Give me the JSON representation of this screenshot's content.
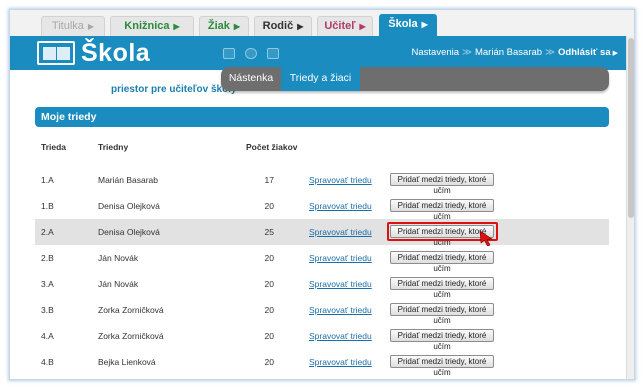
{
  "tabs": [
    {
      "label": "Titulka"
    },
    {
      "label": "Knižnica"
    },
    {
      "label": "Žiak"
    },
    {
      "label": "Rodič"
    },
    {
      "label": "Učiteľ"
    },
    {
      "label": "Škola"
    }
  ],
  "header": {
    "logo": "Škola",
    "tagline": "priestor pre učiteľov školy",
    "nav": {
      "settings": "Nastavenia",
      "user": "Marián Basarab",
      "logout": "Odhlásiť sa"
    }
  },
  "subnav": [
    {
      "label": "Nástenka"
    },
    {
      "label": "Triedy a žiaci"
    }
  ],
  "section": {
    "title": "Moje triedy"
  },
  "table": {
    "headers": {
      "class": "Trieda",
      "teacher": "Triedny",
      "count": "Počet žiakov"
    },
    "rows": [
      {
        "class": "1.A",
        "teacher": "Marián Basarab",
        "count": "17",
        "manage": "Spravovať triedu",
        "add": "Pridať medzi triedy, ktoré učím"
      },
      {
        "class": "1.B",
        "teacher": "Denisa Olejková",
        "count": "20",
        "manage": "Spravovať triedu",
        "add": "Pridať medzi triedy, ktoré učím"
      },
      {
        "class": "2.A",
        "teacher": "Denisa Olejková",
        "count": "25",
        "manage": "Spravovať triedu",
        "add": "Pridať medzi triedy, ktoré učím"
      },
      {
        "class": "2.B",
        "teacher": "Ján Novák",
        "count": "20",
        "manage": "Spravovať triedu",
        "add": "Pridať medzi triedy, ktoré učím"
      },
      {
        "class": "3.A",
        "teacher": "Ján Novák",
        "count": "20",
        "manage": "Spravovať triedu",
        "add": "Pridať medzi triedy, ktoré učím"
      },
      {
        "class": "3.B",
        "teacher": "Zorka Zorničková",
        "count": "20",
        "manage": "Spravovať triedu",
        "add": "Pridať medzi triedy, ktoré učím"
      },
      {
        "class": "4.A",
        "teacher": "Zorka Zorničková",
        "count": "20",
        "manage": "Spravovať triedu",
        "add": "Pridať medzi triedy, ktoré učím"
      },
      {
        "class": "4.B",
        "teacher": "Bejka Lienková",
        "count": "20",
        "manage": "Spravovať triedu",
        "add": "Pridať medzi triedy, ktoré učím"
      }
    ]
  },
  "colors": {
    "brand": "#1b8cbf",
    "highlight": "#d11111"
  }
}
